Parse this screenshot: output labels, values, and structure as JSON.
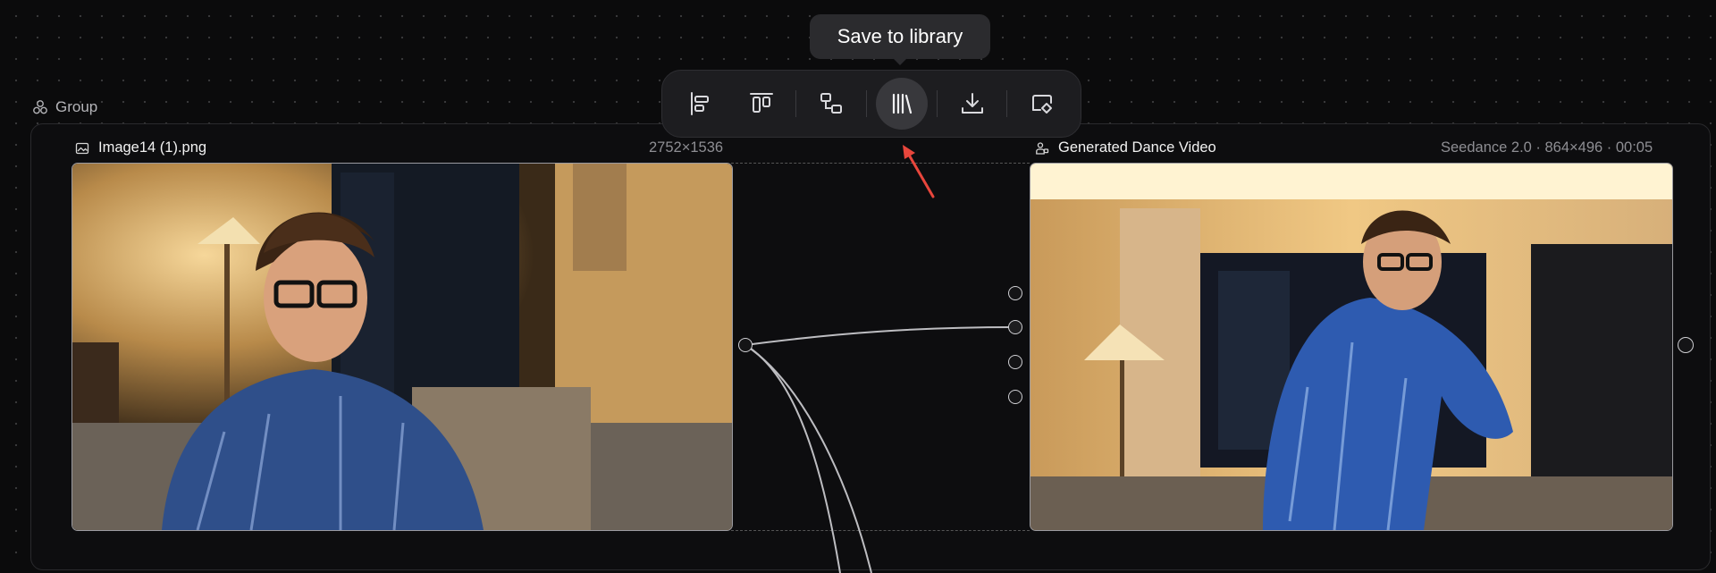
{
  "group": {
    "label": "Group",
    "icon": "group-icon"
  },
  "toolbar": {
    "buttons": [
      {
        "name": "align-left-button",
        "icon": "align-left-icon"
      },
      {
        "name": "align-top-button",
        "icon": "align-top-icon"
      },
      {
        "name": "arrange-button",
        "icon": "arrange-icon"
      },
      {
        "name": "save-to-library-button",
        "icon": "library-icon"
      },
      {
        "name": "download-button",
        "icon": "download-icon"
      },
      {
        "name": "edit-button",
        "icon": "edit-icon"
      }
    ],
    "tooltip": "Save to library"
  },
  "image_node": {
    "title": "Image14 (1).png",
    "dimensions": "2752×1536",
    "icon": "image-icon"
  },
  "video_node": {
    "title": "Generated Dance Video",
    "meta": "Seedance 2.0 · 864×496 · 00:05",
    "icon": "video-icon"
  },
  "colors": {
    "background": "#0b0b0c",
    "toolbar": "#1d1d20",
    "accent_arrow": "#e8463c",
    "border": "#9a9aa0"
  }
}
